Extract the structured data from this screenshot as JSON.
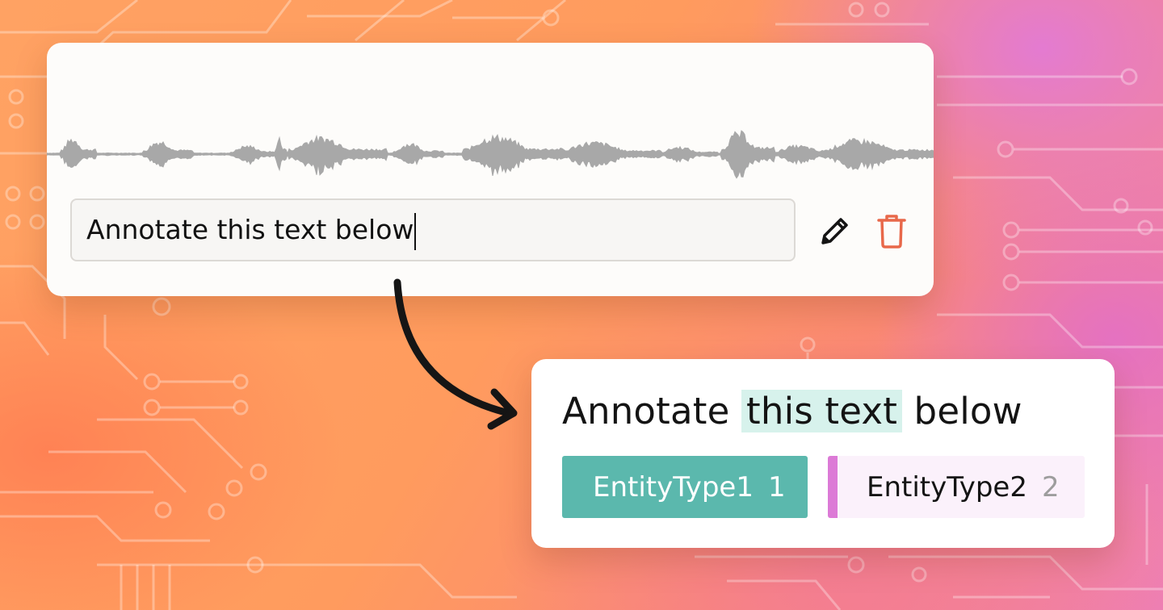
{
  "audio_card": {
    "input_value": "Annotate this text below",
    "edit_icon": "pencil-icon",
    "delete_icon": "trash-icon",
    "delete_icon_color": "#e8684a"
  },
  "annotation_card": {
    "text_before": "Annotate ",
    "text_highlighted": "this text",
    "text_after": " below",
    "highlight_color": "#d7f2ec",
    "entities": [
      {
        "label": "EntityType1",
        "count": "1",
        "color": "#5bb8ad"
      },
      {
        "label": "EntityType2",
        "count": "2",
        "color": "#dc7ad6"
      }
    ]
  }
}
